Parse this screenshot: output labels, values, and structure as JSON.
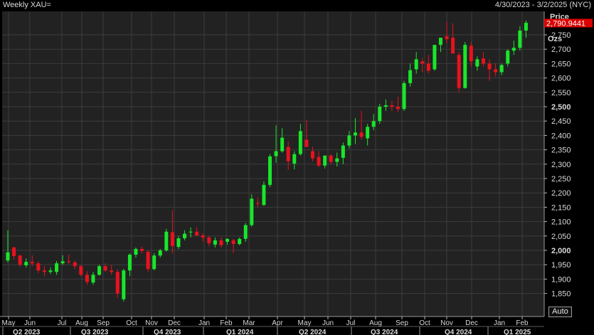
{
  "header": {
    "title": "Weekly XAU=",
    "date_range": "4/30/2023 - 3/2/2025 (NYC)"
  },
  "axis": {
    "price_label": "Price",
    "unit_label": "Ozs",
    "last_price_label": "2,790.9441"
  },
  "auto_button": "Auto",
  "colors": {
    "background": "#222222",
    "grid": "#3c3c3c",
    "up": "#19e62a",
    "down": "#e8121e",
    "last_price_tag": "#d90000",
    "text": "#d8d8d8"
  },
  "chart_data": {
    "type": "candlestick",
    "title": "Weekly XAU=",
    "ylabel": "Ozs",
    "ylim": [
      1810,
      2860
    ],
    "ytick_values": [
      1850,
      1900,
      1950,
      2000,
      2050,
      2100,
      2150,
      2200,
      2250,
      2300,
      2350,
      2400,
      2450,
      2500,
      2550,
      2600,
      2650,
      2700,
      2750
    ],
    "ytick_labels": [
      "1,850",
      "1,900",
      "1,950",
      "2,000",
      "2,050",
      "2,100",
      "2,150",
      "2,200",
      "2,250",
      "2,300",
      "2,350",
      "2,400",
      "2,450",
      "2,500",
      "2,550",
      "2,600",
      "2,650",
      "2,700",
      "2,750"
    ],
    "bold_ticks": [
      "2,000",
      "2,500"
    ],
    "month_labels": [
      "May",
      "Jun",
      "Jul",
      "Aug",
      "Sep",
      "Oct",
      "Nov",
      "Dec",
      "Jan",
      "Feb",
      "Mar",
      "Apr",
      "May",
      "Jun",
      "Jul",
      "Aug",
      "Sep",
      "Oct",
      "Nov",
      "Dec",
      "Jan",
      "Feb"
    ],
    "quarter_labels": [
      "Q2 2023",
      "Q3 2023",
      "Q4 2023",
      "Q1 2024",
      "Q2 2024",
      "Q3 2024",
      "Q4 2024",
      "Q1 2025"
    ],
    "last_price": 2790.9441,
    "candles": [
      {
        "o": 1965,
        "h": 2070,
        "l": 1958,
        "c": 1993
      },
      {
        "o": 2010,
        "h": 2013,
        "l": 1968,
        "c": 1980
      },
      {
        "o": 1982,
        "h": 1985,
        "l": 1942,
        "c": 1950
      },
      {
        "o": 1948,
        "h": 1972,
        "l": 1940,
        "c": 1960
      },
      {
        "o": 1960,
        "h": 1983,
        "l": 1945,
        "c": 1955
      },
      {
        "o": 1955,
        "h": 1962,
        "l": 1920,
        "c": 1930
      },
      {
        "o": 1930,
        "h": 1945,
        "l": 1910,
        "c": 1925
      },
      {
        "o": 1925,
        "h": 1940,
        "l": 1918,
        "c": 1930
      },
      {
        "o": 1925,
        "h": 1963,
        "l": 1915,
        "c": 1955
      },
      {
        "o": 1955,
        "h": 1983,
        "l": 1950,
        "c": 1962
      },
      {
        "o": 1962,
        "h": 1985,
        "l": 1952,
        "c": 1960
      },
      {
        "o": 1958,
        "h": 1965,
        "l": 1935,
        "c": 1945
      },
      {
        "o": 1945,
        "h": 1950,
        "l": 1910,
        "c": 1915
      },
      {
        "o": 1915,
        "h": 1928,
        "l": 1880,
        "c": 1890
      },
      {
        "o": 1888,
        "h": 1925,
        "l": 1880,
        "c": 1915
      },
      {
        "o": 1915,
        "h": 1950,
        "l": 1912,
        "c": 1945
      },
      {
        "o": 1945,
        "h": 1955,
        "l": 1925,
        "c": 1930
      },
      {
        "o": 1930,
        "h": 1950,
        "l": 1915,
        "c": 1925
      },
      {
        "o": 1925,
        "h": 1935,
        "l": 1835,
        "c": 1850
      },
      {
        "o": 1830,
        "h": 1936,
        "l": 1822,
        "c": 1930
      },
      {
        "o": 1930,
        "h": 1990,
        "l": 1910,
        "c": 1985
      },
      {
        "o": 1985,
        "h": 2010,
        "l": 1975,
        "c": 2005
      },
      {
        "o": 2005,
        "h": 2013,
        "l": 1990,
        "c": 1998
      },
      {
        "o": 1995,
        "h": 2000,
        "l": 1925,
        "c": 1935
      },
      {
        "o": 1935,
        "h": 1990,
        "l": 1930,
        "c": 1982
      },
      {
        "o": 1982,
        "h": 2005,
        "l": 1975,
        "c": 2000
      },
      {
        "o": 2000,
        "h": 2075,
        "l": 1995,
        "c": 2065
      },
      {
        "o": 2063,
        "h": 2140,
        "l": 1990,
        "c": 2015
      },
      {
        "o": 2012,
        "h": 2050,
        "l": 2005,
        "c": 2042
      },
      {
        "o": 2042,
        "h": 2070,
        "l": 2035,
        "c": 2058
      },
      {
        "o": 2063,
        "h": 2080,
        "l": 2045,
        "c": 2065
      },
      {
        "o": 2065,
        "h": 2080,
        "l": 2050,
        "c": 2052
      },
      {
        "o": 2052,
        "h": 2060,
        "l": 2030,
        "c": 2045
      },
      {
        "o": 2045,
        "h": 2050,
        "l": 2015,
        "c": 2025
      },
      {
        "o": 2020,
        "h": 2045,
        "l": 2010,
        "c": 2035
      },
      {
        "o": 2035,
        "h": 2045,
        "l": 2010,
        "c": 2018
      },
      {
        "o": 2030,
        "h": 2042,
        "l": 2020,
        "c": 2040
      },
      {
        "o": 2035,
        "h": 2040,
        "l": 1990,
        "c": 2022
      },
      {
        "o": 2022,
        "h": 2045,
        "l": 2018,
        "c": 2040
      },
      {
        "o": 2040,
        "h": 2095,
        "l": 2030,
        "c": 2088
      },
      {
        "o": 2088,
        "h": 2195,
        "l": 2082,
        "c": 2180
      },
      {
        "o": 2165,
        "h": 2185,
        "l": 2150,
        "c": 2162
      },
      {
        "o": 2158,
        "h": 2240,
        "l": 2155,
        "c": 2228
      },
      {
        "o": 2228,
        "h": 2335,
        "l": 2220,
        "c": 2327
      },
      {
        "o": 2328,
        "h": 2435,
        "l": 2305,
        "c": 2345
      },
      {
        "o": 2345,
        "h": 2425,
        "l": 2340,
        "c": 2392
      },
      {
        "o": 2360,
        "h": 2380,
        "l": 2280,
        "c": 2310
      },
      {
        "o": 2302,
        "h": 2345,
        "l": 2282,
        "c": 2335
      },
      {
        "o": 2335,
        "h": 2440,
        "l": 2330,
        "c": 2415
      },
      {
        "o": 2385,
        "h": 2455,
        "l": 2370,
        "c": 2360
      },
      {
        "o": 2345,
        "h": 2360,
        "l": 2310,
        "c": 2320
      },
      {
        "o": 2325,
        "h": 2345,
        "l": 2290,
        "c": 2295
      },
      {
        "o": 2295,
        "h": 2330,
        "l": 2285,
        "c": 2330
      },
      {
        "o": 2330,
        "h": 2335,
        "l": 2300,
        "c": 2308
      },
      {
        "o": 2308,
        "h": 2340,
        "l": 2292,
        "c": 2320
      },
      {
        "o": 2322,
        "h": 2375,
        "l": 2300,
        "c": 2365
      },
      {
        "o": 2365,
        "h": 2415,
        "l": 2355,
        "c": 2400
      },
      {
        "o": 2400,
        "h": 2460,
        "l": 2370,
        "c": 2410
      },
      {
        "o": 2410,
        "h": 2485,
        "l": 2385,
        "c": 2395
      },
      {
        "o": 2390,
        "h": 2440,
        "l": 2365,
        "c": 2430
      },
      {
        "o": 2430,
        "h": 2475,
        "l": 2418,
        "c": 2450
      },
      {
        "o": 2450,
        "h": 2510,
        "l": 2440,
        "c": 2500
      },
      {
        "o": 2500,
        "h": 2525,
        "l": 2485,
        "c": 2505
      },
      {
        "o": 2505,
        "h": 2520,
        "l": 2485,
        "c": 2500
      },
      {
        "o": 2500,
        "h": 2535,
        "l": 2480,
        "c": 2492
      },
      {
        "o": 2492,
        "h": 2590,
        "l": 2485,
        "c": 2582
      },
      {
        "o": 2582,
        "h": 2650,
        "l": 2570,
        "c": 2627
      },
      {
        "o": 2630,
        "h": 2690,
        "l": 2615,
        "c": 2665
      },
      {
        "o": 2658,
        "h": 2670,
        "l": 2620,
        "c": 2650
      },
      {
        "o": 2650,
        "h": 2680,
        "l": 2615,
        "c": 2625
      },
      {
        "o": 2630,
        "h": 2715,
        "l": 2625,
        "c": 2715
      },
      {
        "o": 2715,
        "h": 2735,
        "l": 2690,
        "c": 2740
      },
      {
        "o": 2745,
        "h": 2795,
        "l": 2720,
        "c": 2735
      },
      {
        "o": 2740,
        "h": 2790,
        "l": 2700,
        "c": 2685
      },
      {
        "o": 2680,
        "h": 2690,
        "l": 2550,
        "c": 2565
      },
      {
        "o": 2565,
        "h": 2725,
        "l": 2563,
        "c": 2715
      },
      {
        "o": 2712,
        "h": 2725,
        "l": 2640,
        "c": 2658
      },
      {
        "o": 2640,
        "h": 2675,
        "l": 2625,
        "c": 2665
      },
      {
        "o": 2668,
        "h": 2690,
        "l": 2640,
        "c": 2650
      },
      {
        "o": 2650,
        "h": 2665,
        "l": 2590,
        "c": 2630
      },
      {
        "o": 2630,
        "h": 2650,
        "l": 2605,
        "c": 2620
      },
      {
        "o": 2620,
        "h": 2650,
        "l": 2610,
        "c": 2645
      },
      {
        "o": 2650,
        "h": 2700,
        "l": 2640,
        "c": 2695
      },
      {
        "o": 2695,
        "h": 2730,
        "l": 2680,
        "c": 2705
      },
      {
        "o": 2705,
        "h": 2780,
        "l": 2695,
        "c": 2765
      },
      {
        "o": 2765,
        "h": 2800,
        "l": 2740,
        "c": 2792
      }
    ]
  }
}
